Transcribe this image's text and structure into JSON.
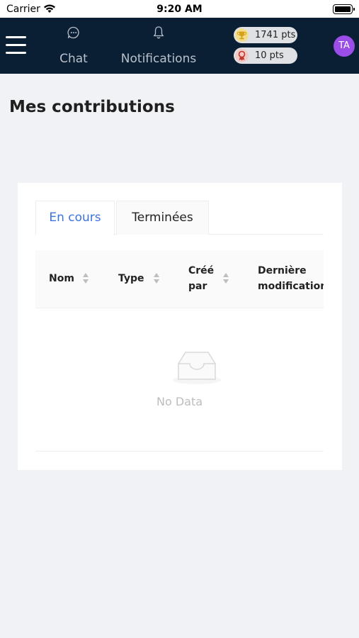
{
  "status_bar": {
    "carrier": "Carrier",
    "time": "9:20 AM"
  },
  "nav": {
    "chat_label": "Chat",
    "notifications_label": "Notifications",
    "points_badge": "1741 pts",
    "rank_badge": "10 pts",
    "avatar_initials": "TA"
  },
  "page": {
    "title": "Mes contributions"
  },
  "tabs": [
    {
      "label": "En cours",
      "active": true
    },
    {
      "label": "Terminées",
      "active": false
    }
  ],
  "table": {
    "columns": [
      "Nom",
      "Type",
      "Créé par",
      "Dernière modification"
    ],
    "empty_text": "No Data"
  },
  "colors": {
    "nav_bg": "#0b1f34",
    "accent": "#3b73e0",
    "avatar": "#9b4de8"
  }
}
